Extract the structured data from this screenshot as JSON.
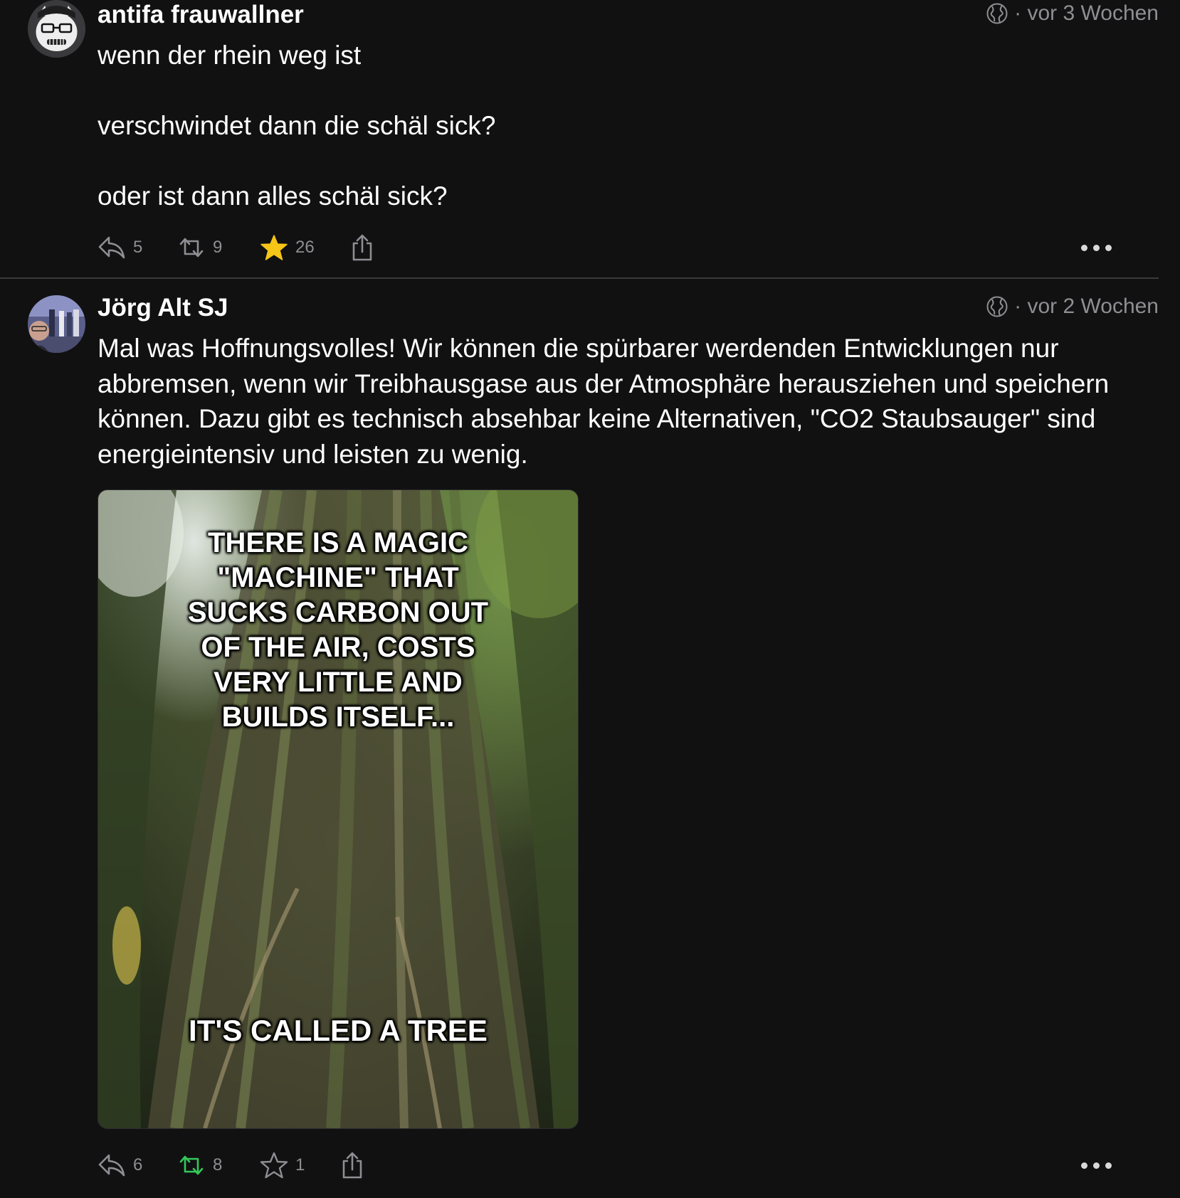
{
  "posts": [
    {
      "author": "antifa frauwallner",
      "visibility_icon": "globe-icon",
      "time": "· vor 3 Wochen",
      "paragraphs": [
        "wenn der rhein weg ist",
        "verschwindet dann die schäl sick?",
        "oder ist dann alles schäl sick?"
      ],
      "replies": "5",
      "boosts": "9",
      "favourites": "26",
      "favourited": true,
      "boosted": false
    },
    {
      "author": "Jörg Alt SJ",
      "visibility_icon": "globe-icon",
      "time": "· vor 2 Wochen",
      "text": "Mal was Hoffnungsvolles! Wir können die spürbarer werdenden Entwicklungen nur abbremsen, wenn wir Treibhausgase aus der Atmosphäre herausziehen und speichern können. Dazu gibt es technisch absehbar keine Alternativen, \"CO2 Staubsauger\" sind energieintensiv und leisten zu wenig.",
      "image_caption_top": "THERE IS A MAGIC \"MACHINE\" THAT SUCKS CARBON OUT OF THE AIR, COSTS VERY LITTLE AND BUILDS ITSELF...",
      "image_caption_bottom": "IT'S CALLED A TREE",
      "replies": "6",
      "boosts": "8",
      "favourites": "1",
      "favourited": false,
      "boosted": true
    }
  ],
  "colors": {
    "background": "#111112",
    "muted": "#8e8e93",
    "favourite": "#f5c518",
    "boost_active": "#34c759"
  }
}
